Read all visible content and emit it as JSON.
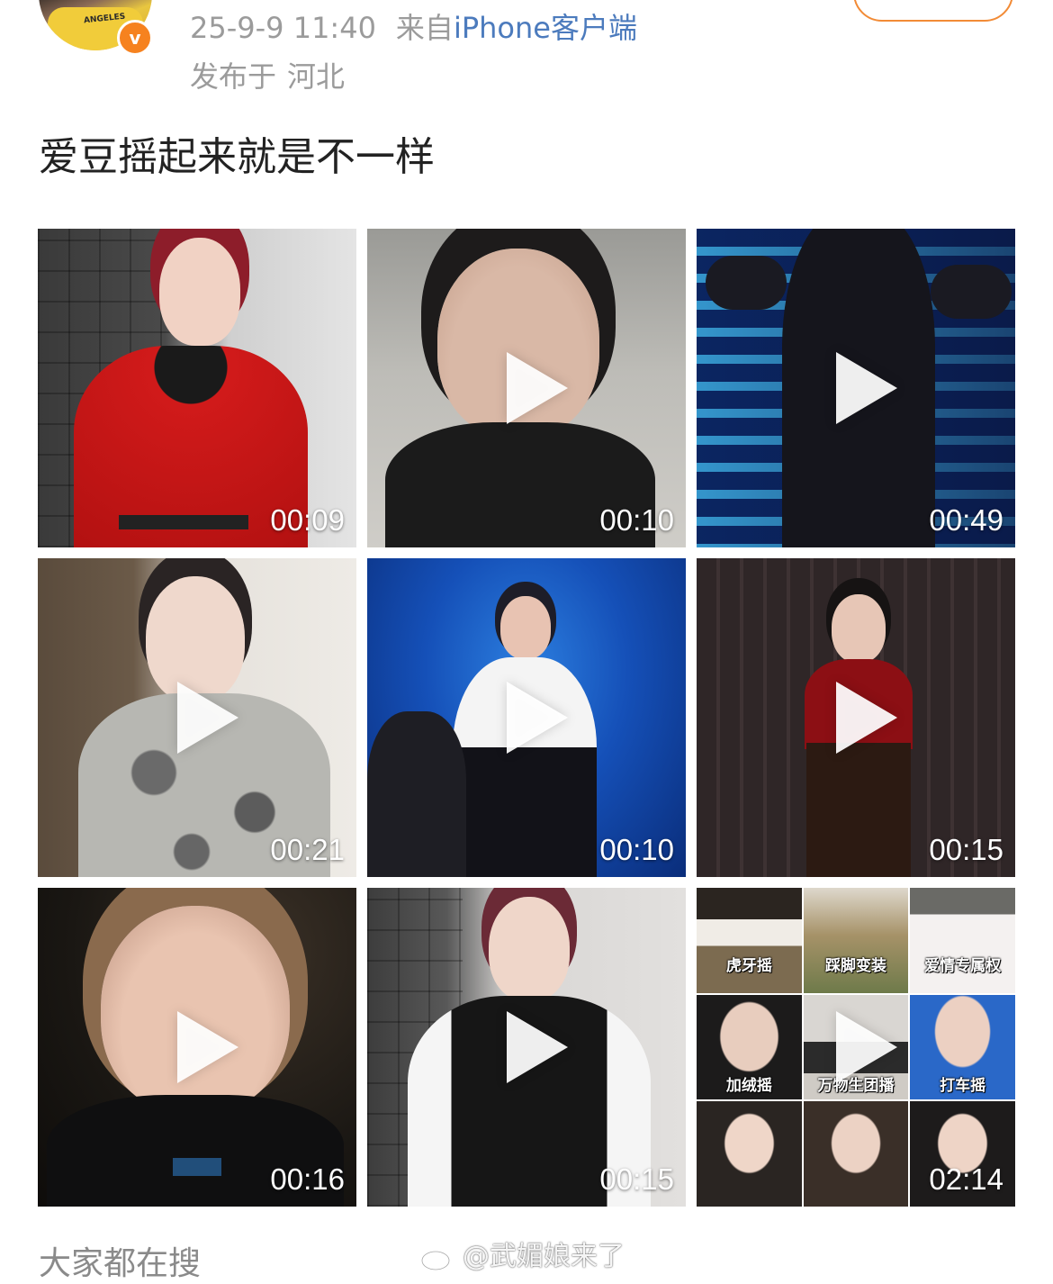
{
  "header": {
    "avatar_shirt_text": "ANGELES",
    "verified_badge": "v",
    "timestamp": "25-9-9 11:40",
    "source_prefix": "来自",
    "source_client": "iPhone客户端",
    "location_label": "发布于",
    "location_value": "河北"
  },
  "post": {
    "text": "爱豆摇起来就是不一样"
  },
  "videos": [
    {
      "duration": "00:09",
      "icon": "play-icon"
    },
    {
      "duration": "00:10",
      "icon": "play-icon"
    },
    {
      "duration": "00:49",
      "icon": "play-icon"
    },
    {
      "duration": "00:21",
      "icon": "play-icon"
    },
    {
      "duration": "00:10",
      "icon": "play-icon"
    },
    {
      "duration": "00:15",
      "icon": "play-icon"
    },
    {
      "duration": "00:16",
      "icon": "play-icon"
    },
    {
      "duration": "00:15",
      "icon": "play-icon"
    },
    {
      "duration": "02:14",
      "icon": "play-icon",
      "collage_labels": [
        "虎牙摇",
        "踩脚变装",
        "爱情专属权",
        "加绒摇",
        "万物生团播",
        "打车摇"
      ]
    }
  ],
  "footer": {
    "trending_title": "大家都在搜",
    "watermark": "@武媚娘来了",
    "watermark_icon": "weibo-logo-icon"
  },
  "colors": {
    "link": "#4c7bbd",
    "meta_gray": "#9b9b9b",
    "badge_orange": "#f6821f",
    "follow_border": "#f28b36"
  }
}
